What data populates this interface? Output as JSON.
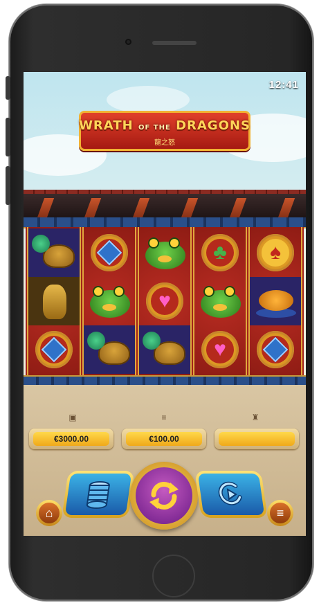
{
  "status_bar": {
    "time": "12:41"
  },
  "game": {
    "title_main": "WRATH",
    "title_of": "OF THE",
    "title_end": "DRAGONS",
    "subtitle": "龍之怒"
  },
  "reels": [
    [
      "turtle-dragon",
      "monkey-statue",
      "blue-diamond-coin"
    ],
    [
      "blue-diamond-coin",
      "jade-toad",
      "turtle-dragon"
    ],
    [
      "jade-toad",
      "heart-coin",
      "turtle-dragon"
    ],
    [
      "club-coin",
      "jade-toad",
      "heart-coin"
    ],
    [
      "spade-coin",
      "koi-fish",
      "blue-diamond-coin"
    ]
  ],
  "hud": {
    "balance_icon": "wallet-icon",
    "balance": "€3000.00",
    "bet_icon": "coins-icon",
    "bet": "€100.00",
    "win_icon": "trophy-icon",
    "win": ""
  },
  "controls": {
    "home_icon": "home-icon",
    "bet_button_icon": "coin-stack-icon",
    "spin_icon": "spin-arrows-icon",
    "autoplay_icon": "autoplay-icon",
    "menu_icon": "hamburger-menu-icon"
  },
  "colors": {
    "frame_gold": "#f2b233",
    "reel_red": "#a2231a",
    "spin_purple": "#6a1a86",
    "button_blue": "#1a5aa8"
  }
}
